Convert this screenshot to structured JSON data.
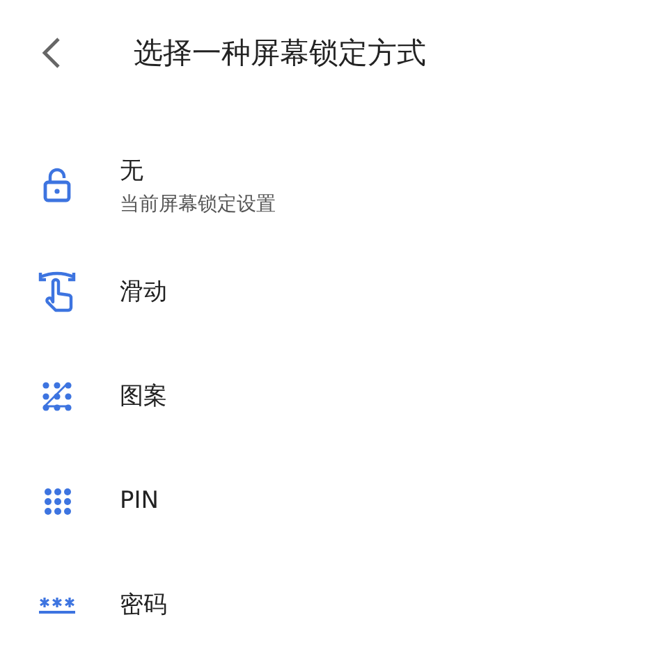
{
  "header": {
    "title": "选择一种屏幕锁定方式"
  },
  "options": [
    {
      "kind": "none",
      "label": "无",
      "subtitle": "当前屏幕锁定设置"
    },
    {
      "kind": "swipe",
      "label": "滑动"
    },
    {
      "kind": "pattern",
      "label": "图案"
    },
    {
      "kind": "pin",
      "label": "PIN"
    },
    {
      "kind": "password",
      "label": "密码"
    }
  ]
}
